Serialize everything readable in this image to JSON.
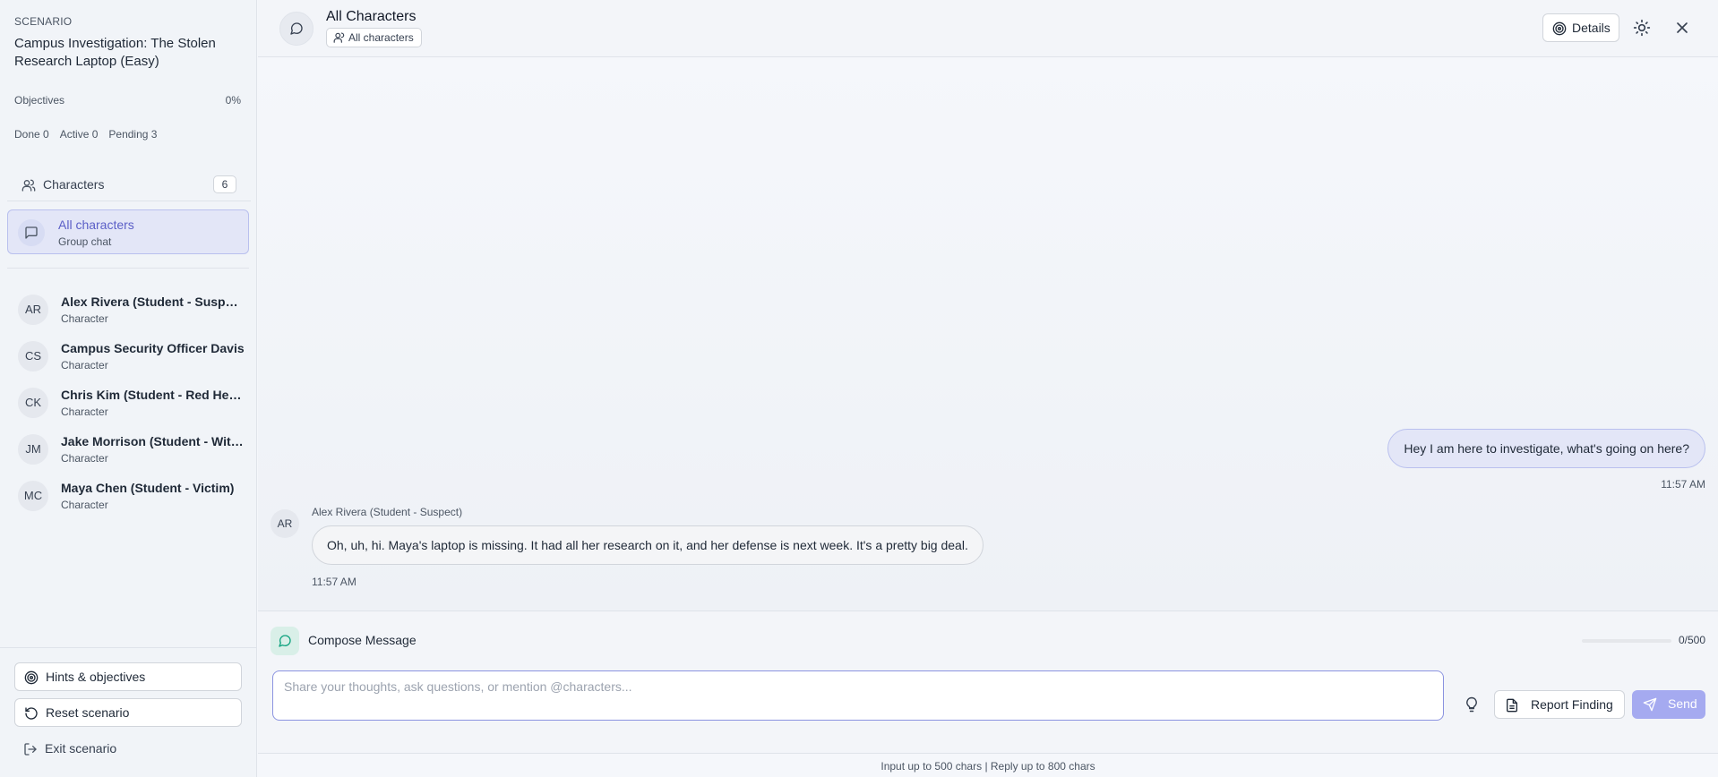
{
  "sidebar": {
    "scenario_label": "SCENARIO",
    "scenario_title": "Campus Investigation: The Stolen Research Laptop (Easy)",
    "objectives_label": "Objectives",
    "objectives_percent": "0%",
    "stats": {
      "done": "Done 0",
      "active": "Active 0",
      "pending": "Pending 3"
    },
    "characters_label": "Characters",
    "characters_count": "6",
    "all_characters": {
      "label": "All characters",
      "sub": "Group chat"
    },
    "characters": [
      {
        "initials": "AR",
        "name": "Alex Rivera (Student - Suspect)",
        "type": "Character"
      },
      {
        "initials": "CS",
        "name": "Campus Security Officer Davis",
        "type": "Character"
      },
      {
        "initials": "CK",
        "name": "Chris Kim (Student - Red Herring)",
        "type": "Character"
      },
      {
        "initials": "JM",
        "name": "Jake Morrison (Student - Witness)",
        "type": "Character"
      },
      {
        "initials": "MC",
        "name": "Maya Chen (Student - Victim)",
        "type": "Character"
      }
    ],
    "hints_label": "Hints & objectives",
    "reset_label": "Reset scenario",
    "exit_label": "Exit scenario"
  },
  "header": {
    "title": "All Characters",
    "badge": "All characters",
    "details_label": "Details"
  },
  "messages": {
    "user_text": "Hey I am here to investigate, what's going on here?",
    "user_time": "11:57 AM",
    "bot_initials": "AR",
    "bot_name": "Alex Rivera (Student - Suspect)",
    "bot_text": "Oh, uh, hi. Maya's laptop is missing. It had all her research on it, and her defense is next week. It's a pretty big deal.",
    "bot_time": "11:57 AM"
  },
  "composer": {
    "title": "Compose Message",
    "count": "0/500",
    "placeholder": "Share your thoughts, ask questions, or mention @characters...",
    "report_label": "Report Finding",
    "send_label": "Send",
    "footer_note": "Input up to 500 chars | Reply up to 800 chars"
  },
  "colors": {
    "accent": "#5b5fc7",
    "send": "#a5aaf0",
    "selected_bg": "#e3e6f7"
  }
}
